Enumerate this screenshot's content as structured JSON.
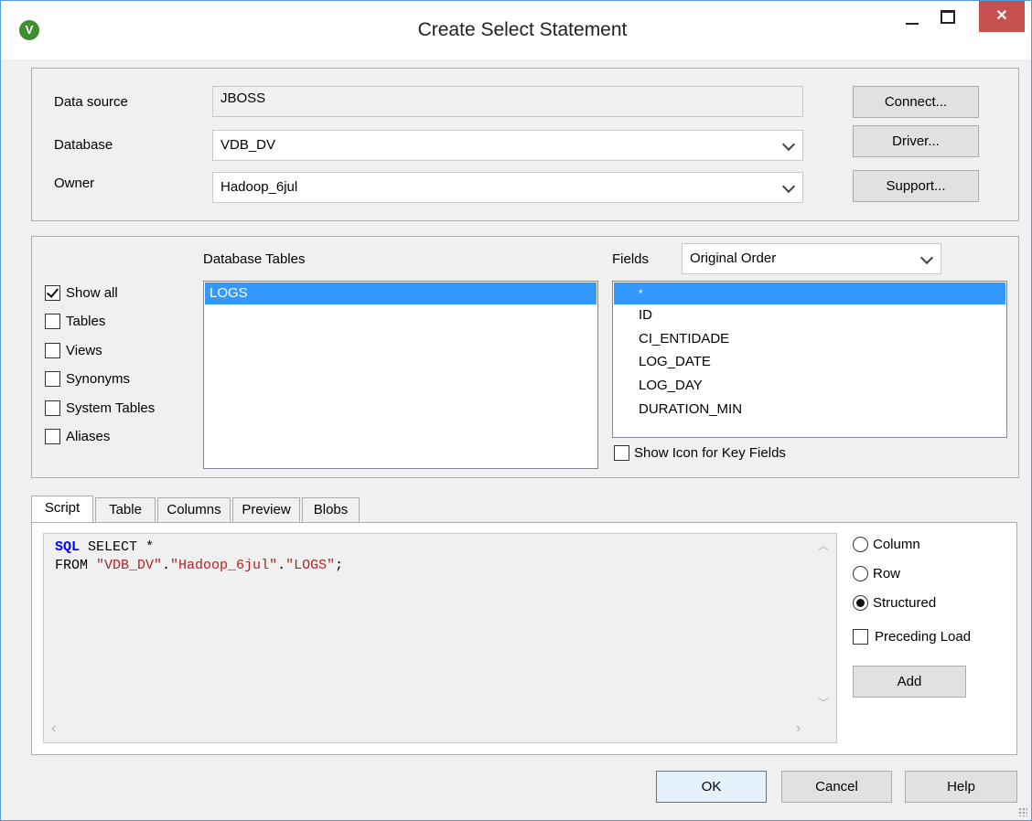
{
  "window": {
    "title": "Create Select Statement",
    "app_icon": "V",
    "minimize": "—",
    "close": "✕"
  },
  "connection": {
    "data_source_label": "Data source",
    "data_source_value": "JBOSS",
    "database_label": "Database",
    "database_value": "VDB_DV",
    "owner_label": "Owner",
    "owner_value": "Hadoop_6jul",
    "connect_button": "Connect...",
    "driver_button": "Driver...",
    "support_button": "Support..."
  },
  "filters": {
    "items": [
      {
        "label": "Show all",
        "checked": true
      },
      {
        "label": "Tables",
        "checked": false
      },
      {
        "label": "Views",
        "checked": false
      },
      {
        "label": "Synonyms",
        "checked": false
      },
      {
        "label": "System Tables",
        "checked": false
      },
      {
        "label": "Aliases",
        "checked": false
      }
    ]
  },
  "tables": {
    "header": "Database Tables",
    "items": [
      "LOGS"
    ],
    "selected": "LOGS"
  },
  "fields": {
    "label": "Fields",
    "order_value": "Original Order",
    "items": [
      "*",
      "ID",
      "CI_ENTIDADE",
      "LOG_DATE",
      "LOG_DAY",
      "DURATION_MIN"
    ],
    "selected": "*",
    "show_key_icon_label": "Show Icon for Key Fields"
  },
  "tabs": [
    "Script",
    "Table",
    "Columns",
    "Preview",
    "Blobs"
  ],
  "active_tab": "Script",
  "script": {
    "line1_kw": "SQL",
    "line1_rest": " SELECT *",
    "line2_from": "FROM ",
    "line2_db": "\"VDB_DV\"",
    "line2_dot1": ".",
    "line2_owner": "\"Hadoop_6jul\"",
    "line2_dot2": ".",
    "line2_table": "\"LOGS\"",
    "line2_end": ";"
  },
  "script_options": {
    "column_label": "Column",
    "row_label": "Row",
    "structured_label": "Structured",
    "selected": "Structured",
    "preceding_load_label": "Preceding Load",
    "add_button": "Add"
  },
  "footer": {
    "ok": "OK",
    "cancel": "Cancel",
    "help": "Help"
  },
  "colors": {
    "selection": "#3399ff",
    "close_button": "#c75050",
    "keyword": "#0000ff",
    "string": "#b22222"
  }
}
